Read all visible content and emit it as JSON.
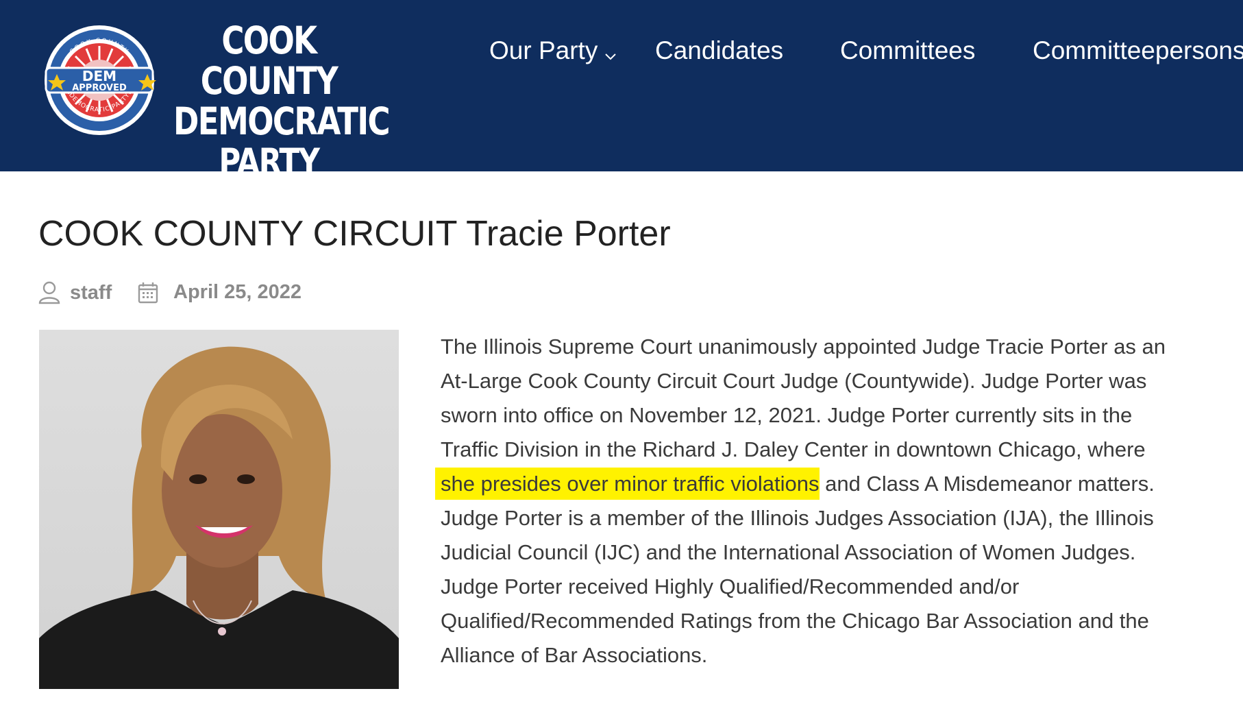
{
  "logo": {
    "badge": {
      "ring_top": "COOK COUNTY",
      "ring_bottom": "DEMOCRATIC PARTY",
      "center_top": "DEM",
      "center_bottom": "APPROVED"
    },
    "line1": "COOK COUNTY",
    "line2": "DEMOCRATIC",
    "line3": "PARTY"
  },
  "nav": {
    "items": [
      {
        "label": "Our Party",
        "has_dropdown": true
      },
      {
        "label": "Candidates"
      },
      {
        "label": "Committees"
      },
      {
        "label": "Committeepersons"
      }
    ]
  },
  "article": {
    "title": "COOK COUNTY CIRCUIT Tracie Porter",
    "author": "staff",
    "date": "April 25, 2022",
    "author_icon": "user-icon",
    "date_icon": "calendar-icon",
    "body_lines": [
      "The Illinois Supreme Court unanimously appointed Judge Tracie Porter as an",
      "At-Large Cook County Circuit Court Judge (Countywide). Judge Porter was",
      "sworn into office on November 12, 2021. Judge Porter currently sits in the",
      "Traffic Division in the Richard J. Daley Center in downtown Chicago, where",
      "",
      "Judge Porter is a member of the Illinois Judges Association (IJA), the Illinois",
      "Judicial Council (IJC) and the International Association of Women Judges.",
      "Judge Porter received Highly Qualified/Recommended and/or",
      "Qualified/Recommended Ratings from the Chicago Bar Association and the",
      "Alliance of Bar Associations."
    ],
    "highlight_text": "she presides over minor traffic violations",
    "after_highlight_text": " and Class A Misdemeanor matters."
  },
  "colors": {
    "header_bg": "#0f2d5e",
    "highlight": "#fff200",
    "meta_gray": "#8a8a8a"
  }
}
